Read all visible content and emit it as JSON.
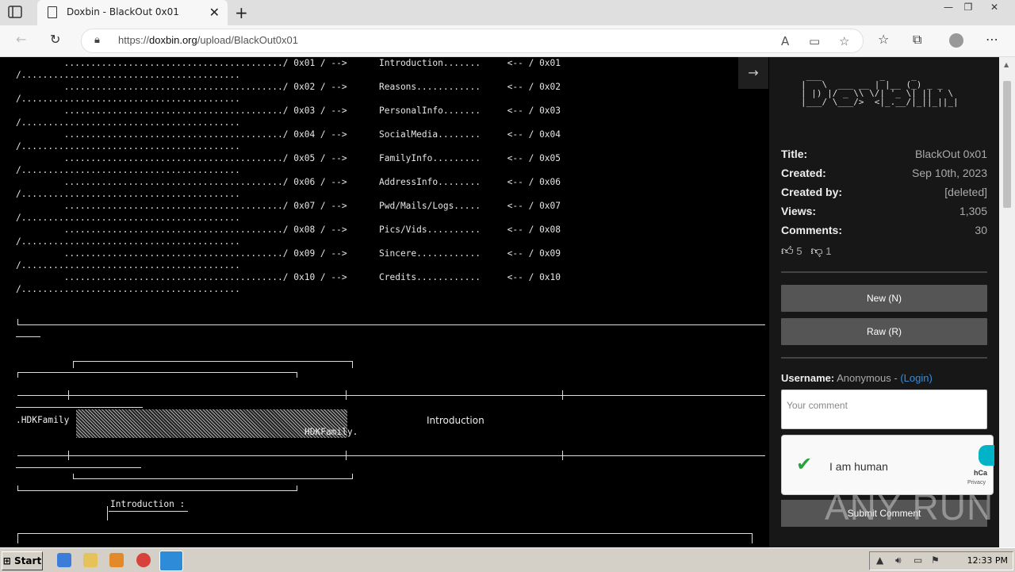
{
  "browser": {
    "tab_title": "Doxbin - BlackOut 0x01",
    "url_prefix": "https://",
    "url_domain": "doxbin.org",
    "url_path": "/upload/BlackOut0x01"
  },
  "paste": {
    "toc_text": "         ........................................./ 0x01 / -->      Introduction.......     <-- / 0x01\n/.........................................\n         ........................................./ 0x02 / -->      Reasons............     <-- / 0x02\n/.........................................\n         ........................................./ 0x03 / -->      PersonalInfo.......     <-- / 0x03\n/.........................................\n         ........................................./ 0x04 / -->      SocialMedia........     <-- / 0x04\n/.........................................\n         ........................................./ 0x05 / -->      FamilyInfo.........     <-- / 0x05\n/.........................................\n         ........................................./ 0x06 / -->      AddressInfo........     <-- / 0x06\n/.........................................\n         ........................................./ 0x07 / -->      Pwd/Mails/Logs.....     <-- / 0x07\n/.........................................\n         ........................................./ 0x08 / -->      Pics/Vids..........     <-- / 0x08\n/.........................................\n         ........................................./ 0x09 / -->      Sincere............     <-- / 0x09\n/.........................................\n         ........................................./ 0x10 / -->      Credits............     <-- / 0x10\n/.........................................",
    "banner_left": ".HDKFamily",
    "banner_right": "HDKFamily.",
    "banner_title": "Introduction",
    "section_heading": "Introduction :"
  },
  "sidebar": {
    "logo_ascii": " ___           _     _\n|   \\  ___ __ | |__ (_) _ _\n| |) |/ _ \\\\ \\/| '_ \\| || ' \\\n|___/ \\___/>  <|_.__/|_||_||_|",
    "meta": [
      {
        "key": "Title:",
        "value": "BlackOut 0x01"
      },
      {
        "key": "Created:",
        "value": "Sep 10th, 2023"
      },
      {
        "key": "Created by:",
        "value": "[deleted]"
      },
      {
        "key": "Views:",
        "value": "1,305"
      },
      {
        "key": "Comments:",
        "value": "30"
      }
    ],
    "likes": "5",
    "dislikes": "1",
    "new_button": "New (N)",
    "raw_button": "Raw (R)",
    "username_label": "Username:",
    "username_value": "Anonymous - ",
    "login_link": "(Login)",
    "comment_placeholder": "Your comment",
    "captcha_text": "I am human",
    "captcha_brand": "hCa",
    "captcha_privacy": "Privacy",
    "submit_button": "Submit Comment"
  },
  "watermark": "ANY RUN",
  "taskbar": {
    "start_label": "Start",
    "clock": "12:33 PM"
  },
  "colors": {
    "paste_bg": "#000000",
    "sidebar_bg": "#171717",
    "button_bg": "#555555",
    "login_link": "#3b8dd8",
    "captcha_check": "#2aa13a"
  }
}
